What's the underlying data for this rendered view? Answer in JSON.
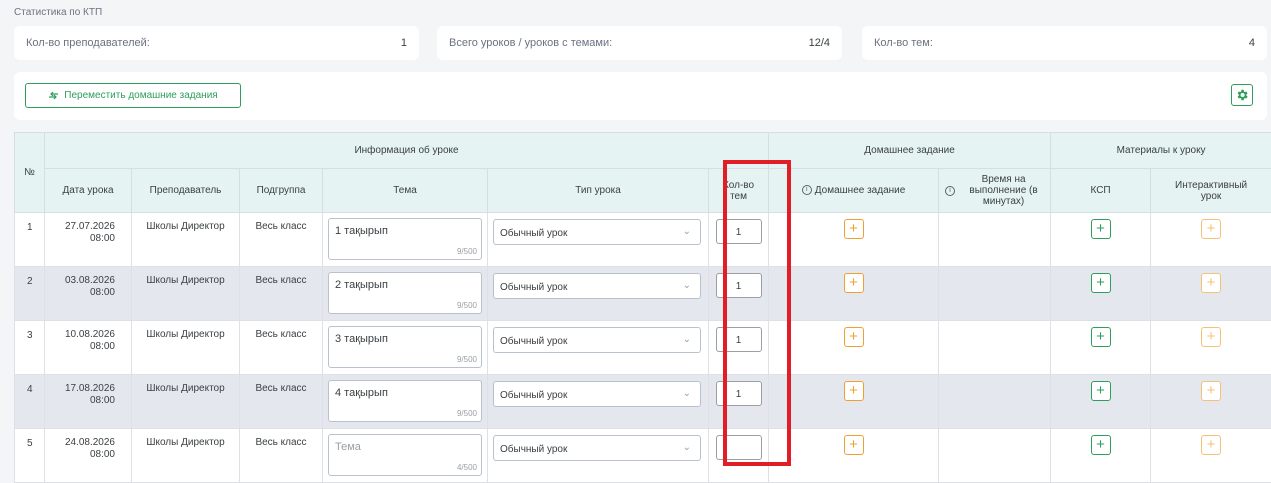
{
  "section_title": "Статистика по КТП",
  "stats": [
    {
      "label": "Кол-во преподавателей:",
      "value": "1"
    },
    {
      "label": "Всего уроков / уроков с темами:",
      "value": "12/4"
    },
    {
      "label": "Кол-во тем:",
      "value": "4"
    }
  ],
  "toolbar": {
    "move_homework_label": "Переместить домашние задания"
  },
  "table": {
    "group_headers": {
      "num": "№",
      "lesson_info": "Информация об уроке",
      "homework": "Домашнее задание",
      "materials": "Материалы к уроку"
    },
    "columns": {
      "date": "Дата урока",
      "teacher": "Преподаватель",
      "subgroup": "Подгруппа",
      "topic": "Тема",
      "lesson_type": "Тип урока",
      "topic_count": "Кол-во тем",
      "homework": "Домашнее задание",
      "time": "Время на выполнение (в минутах)",
      "ksp": "КСП",
      "interactive": "Интерактивный урок"
    },
    "topic_placeholder": "Тема",
    "rows": [
      {
        "num": "1",
        "date": "27.07.2026",
        "time": "08:00",
        "teacher": "Школы Директор",
        "subgroup": "Весь класс",
        "topic": "1 тақырып",
        "counter": "9/500",
        "lesson_type": "Обычный урок",
        "topic_count": "1"
      },
      {
        "num": "2",
        "date": "03.08.2026",
        "time": "08:00",
        "teacher": "Школы Директор",
        "subgroup": "Весь класс",
        "topic": "2 тақырып",
        "counter": "9/500",
        "lesson_type": "Обычный урок",
        "topic_count": "1"
      },
      {
        "num": "3",
        "date": "10.08.2026",
        "time": "08:00",
        "teacher": "Школы Директор",
        "subgroup": "Весь класс",
        "topic": "3 тақырып",
        "counter": "9/500",
        "lesson_type": "Обычный урок",
        "topic_count": "1"
      },
      {
        "num": "4",
        "date": "17.08.2026",
        "time": "08:00",
        "teacher": "Школы Директор",
        "subgroup": "Весь класс",
        "topic": "4 тақырып",
        "counter": "9/500",
        "lesson_type": "Обычный урок",
        "topic_count": "1"
      },
      {
        "num": "5",
        "date": "24.08.2026",
        "time": "08:00",
        "teacher": "Школы Директор",
        "subgroup": "Весь класс",
        "topic": "",
        "counter": "4/500",
        "lesson_type": "Обычный урок",
        "topic_count": ""
      }
    ]
  },
  "colors": {
    "accent_green": "#2e9e5b",
    "accent_orange": "#f0a030",
    "highlight_red": "#e11e26",
    "header_bg": "#e6f3f3"
  }
}
